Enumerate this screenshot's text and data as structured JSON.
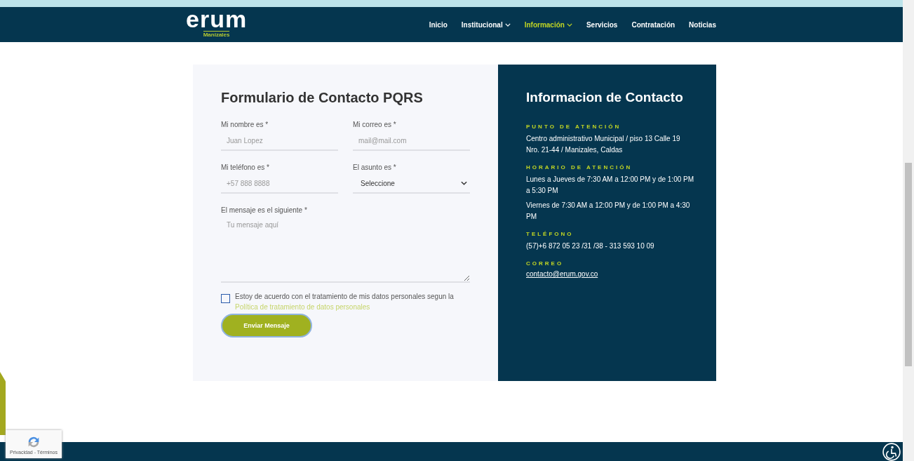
{
  "header": {
    "logo": {
      "word": "erum",
      "city": "Manizales"
    },
    "nav": [
      {
        "label": "Inicio",
        "selected": false,
        "dropdown": false
      },
      {
        "label": "Institucional",
        "selected": false,
        "dropdown": true
      },
      {
        "label": "Información",
        "selected": true,
        "dropdown": true
      },
      {
        "label": "Servicios",
        "selected": false,
        "dropdown": false
      },
      {
        "label": "Contratación",
        "selected": false,
        "dropdown": false
      },
      {
        "label": "Noticias",
        "selected": false,
        "dropdown": false
      }
    ]
  },
  "form": {
    "title": "Formulario de Contacto PQRS",
    "fields": [
      {
        "kind": "text",
        "label": "Mi nombre es *",
        "placeholder": "Juan Lopez"
      },
      {
        "kind": "text",
        "label": "Mi correo es *",
        "placeholder": "mail@mail.com"
      },
      {
        "kind": "text",
        "label": "Mi teléfono es *",
        "placeholder": "+57 888 8888"
      },
      {
        "kind": "select",
        "label": "El asunto es *",
        "value": "Seleccione"
      },
      {
        "kind": "textarea",
        "label": "El mensaje es el siguiente *",
        "placeholder": "Tu mensaje aquí"
      }
    ],
    "consent": {
      "checked": false,
      "text": "Estoy de acuerdo con el tratamiento de mis datos personales segun la",
      "link": "Política de tratamiento de datos personales"
    },
    "submit": "Enviar Mensaje"
  },
  "contact": {
    "title": "Informacion de Contacto",
    "sections": [
      {
        "heading": "PUNTO DE ATENCIÓN",
        "lines": [
          "Centro administrativo Municipal / piso 13 Calle 19 Nro. 21-44 / Manizales, Caldas"
        ]
      },
      {
        "heading": "HORARIO DE ATENCIÓN",
        "lines": [
          "Lunes a Jueves de 7:30 AM a 12:00 PM y de 1:00 PM a 5:30 PM",
          "Viernes de 7:30 AM a 12:00 PM y de 1:00 PM a 4:30 PM"
        ]
      },
      {
        "heading": "TELÉFONO",
        "lines": [
          "(57)+6 872 05 23 /31 /38 - 313 593 10 09"
        ]
      },
      {
        "heading": "CORREO",
        "link": "contacto@erum.gov.co"
      }
    ]
  },
  "recaptcha": {
    "text": "Privacidad - Términos"
  }
}
